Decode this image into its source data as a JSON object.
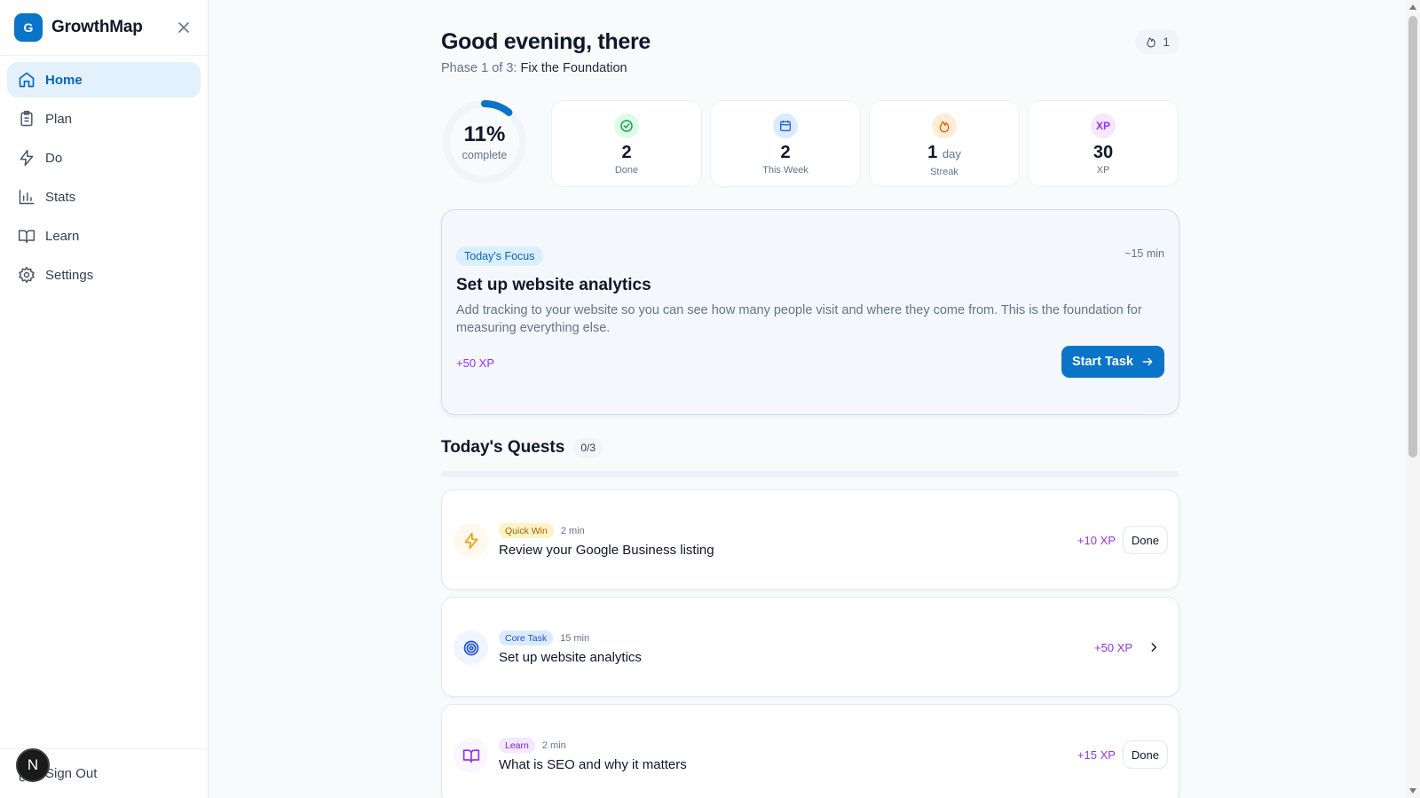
{
  "brand": {
    "logo_letter": "G",
    "name": "GrowthMap"
  },
  "nav": {
    "items": [
      {
        "label": "Home",
        "icon": "home-icon",
        "active": true
      },
      {
        "label": "Plan",
        "icon": "clipboard-icon"
      },
      {
        "label": "Do",
        "icon": "lightning-icon"
      },
      {
        "label": "Stats",
        "icon": "bar-chart-icon"
      },
      {
        "label": "Learn",
        "icon": "book-icon"
      },
      {
        "label": "Settings",
        "icon": "gear-icon"
      }
    ],
    "signout_label": "Sign Out",
    "user_badge": "N"
  },
  "header": {
    "greeting": "Good evening, there",
    "phase_prefix": "Phase 1 of 3: ",
    "phase_name": "Fix the Foundation",
    "streak_count": "1"
  },
  "progress": {
    "percent": 11,
    "percent_label": "11%",
    "label": "complete"
  },
  "stats": [
    {
      "value": "2",
      "unit": "",
      "label": "Done",
      "icon": "check-circle-icon",
      "color": "#16a34a",
      "bg": "#dcfce7"
    },
    {
      "value": "2",
      "unit": "",
      "label": "This Week",
      "icon": "calendar-icon",
      "color": "#2563eb",
      "bg": "#dbeafe"
    },
    {
      "value": "1",
      "unit": "day",
      "label": "Streak",
      "icon": "flame-icon",
      "color": "#ea580c",
      "bg": "#ffedd5"
    },
    {
      "value": "30",
      "unit": "",
      "label": "XP",
      "icon": "xp-icon",
      "icon_text": "XP",
      "color": "#9333ea",
      "bg": "#f3e8ff"
    }
  ],
  "focus": {
    "tag": "Today's Focus",
    "time": "~15 min",
    "title": "Set up website analytics",
    "description": "Add tracking to your website so you can see how many people visit and where they come from. This is the foundation for measuring everything else.",
    "xp": "+50 XP",
    "cta": "Start Task"
  },
  "quests": {
    "title": "Today's Quests",
    "count": "0/3",
    "progress": 0,
    "items": [
      {
        "tag": "Quick Win",
        "tag_color": "#a16207",
        "tag_bg": "#fef3c7",
        "icon": "lightning-icon",
        "icon_color": "#f59e0b",
        "icon_bg": "#fef9ec",
        "time": "2 min",
        "title": "Review your Google Business listing",
        "xp": "+10 XP",
        "action": "Done"
      },
      {
        "tag": "Core Task",
        "tag_color": "#1d4ed8",
        "tag_bg": "#dbeafe",
        "icon": "target-icon",
        "icon_color": "#1d4ed8",
        "icon_bg": "#eff6ff",
        "time": "15 min",
        "title": "Set up website analytics",
        "xp": "+50 XP",
        "action": ""
      },
      {
        "tag": "Learn",
        "tag_color": "#7e22ce",
        "tag_bg": "#f3e8ff",
        "icon": "book-icon",
        "icon_color": "#9333ea",
        "icon_bg": "#faf5ff",
        "time": "2 min",
        "title": "What is SEO and why it matters",
        "xp": "+15 XP",
        "action": "Done"
      }
    ]
  },
  "colors": {
    "accent": "#0a74c9",
    "xp": "#9333ea",
    "active_nav_bg": "#e3f1fc"
  }
}
